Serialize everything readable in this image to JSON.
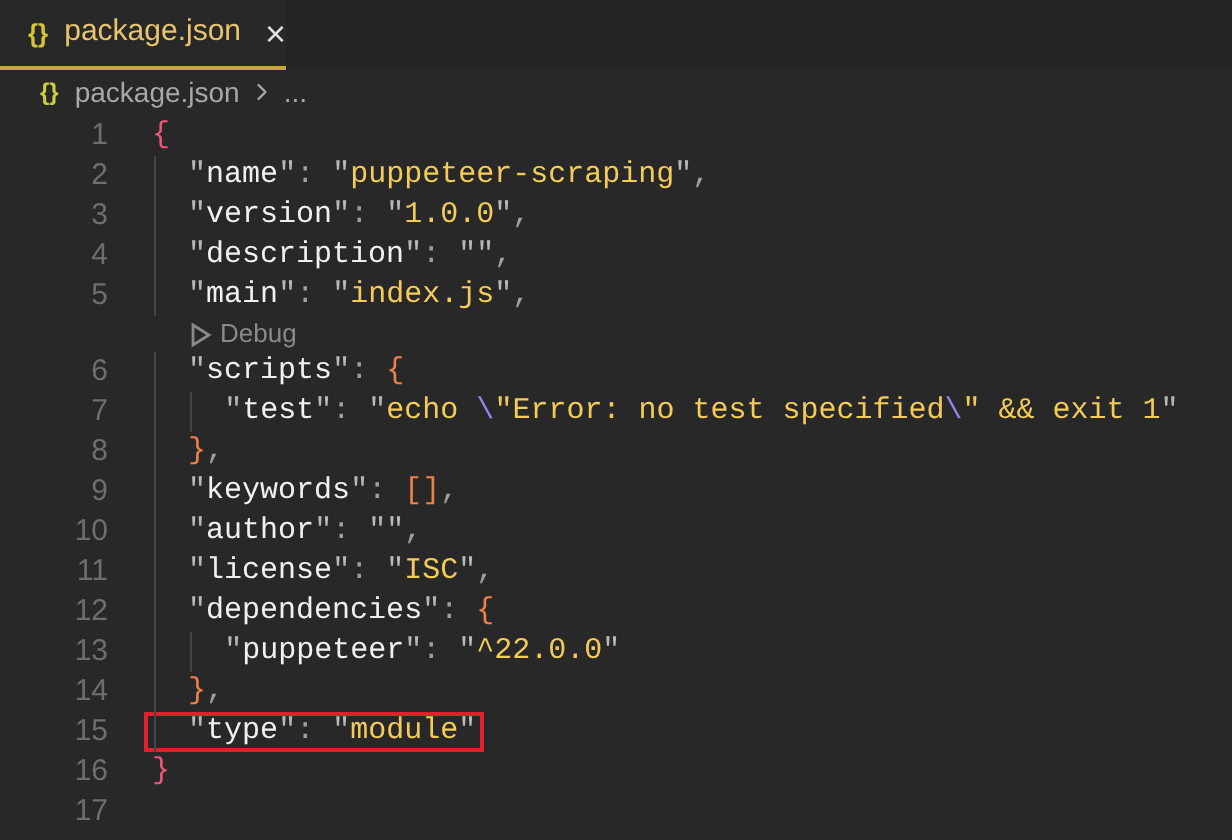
{
  "tab": {
    "icon": "{}",
    "label": "package.json",
    "close": "×",
    "selected": true
  },
  "breadcrumb": {
    "icon": "{}",
    "file": "package.json",
    "more": "..."
  },
  "lines": [
    {
      "kind": "code",
      "number": "1",
      "highlighted": false,
      "text": "{"
    },
    {
      "kind": "code",
      "number": "2",
      "highlighted": false,
      "text": "  \"name\": \"puppeteer-scraping\","
    },
    {
      "kind": "code",
      "number": "3",
      "highlighted": false,
      "text": "  \"version\": \"1.0.0\","
    },
    {
      "kind": "code",
      "number": "4",
      "highlighted": false,
      "text": "  \"description\": \"\","
    },
    {
      "kind": "code",
      "number": "5",
      "highlighted": false,
      "text": "  \"main\": \"index.js\","
    },
    {
      "kind": "codelens",
      "label": "Debug"
    },
    {
      "kind": "code",
      "number": "6",
      "highlighted": false,
      "text": "  \"scripts\": {"
    },
    {
      "kind": "code",
      "number": "7",
      "highlighted": false,
      "text": "    \"test\": \"echo \\\"Error: no test specified\\\" && exit 1\""
    },
    {
      "kind": "code",
      "number": "8",
      "highlighted": false,
      "text": "  },"
    },
    {
      "kind": "code",
      "number": "9",
      "highlighted": false,
      "text": "  \"keywords\": [],"
    },
    {
      "kind": "code",
      "number": "10",
      "highlighted": false,
      "text": "  \"author\": \"\","
    },
    {
      "kind": "code",
      "number": "11",
      "highlighted": false,
      "text": "  \"license\": \"ISC\","
    },
    {
      "kind": "code",
      "number": "12",
      "highlighted": false,
      "text": "  \"dependencies\": {"
    },
    {
      "kind": "code",
      "number": "13",
      "highlighted": false,
      "text": "    \"puppeteer\": \"^22.0.0\""
    },
    {
      "kind": "code",
      "number": "14",
      "highlighted": false,
      "text": "  },"
    },
    {
      "kind": "code",
      "number": "15",
      "highlighted": true,
      "text": "  \"type\": \"module\""
    },
    {
      "kind": "code",
      "number": "16",
      "highlighted": false,
      "text": "}"
    },
    {
      "kind": "code",
      "number": "17",
      "highlighted": false
    }
  ]
}
